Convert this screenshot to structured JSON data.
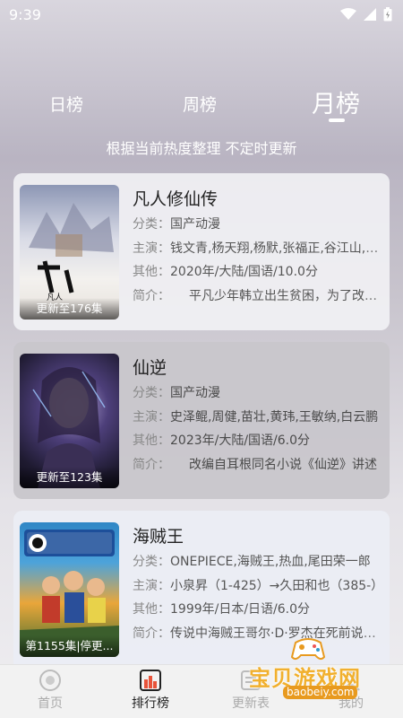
{
  "status": {
    "time": "9:39"
  },
  "tabs": [
    {
      "label": "日榜"
    },
    {
      "label": "周榜"
    },
    {
      "label": "月榜",
      "selected": true
    }
  ],
  "subtitle": "根据当前热度整理 不定时更新",
  "items": [
    {
      "title": "凡人修仙传",
      "badge": "更新至176集",
      "rows": [
        {
          "key": "分类：",
          "value": "国产动漫"
        },
        {
          "key": "主演：",
          "value": "钱文青,杨天翔,杨默,张福正,谷江山,于镜"
        },
        {
          "key": "其他：",
          "value": "2020年/大陆/国语/10.0分"
        },
        {
          "key": "简介：",
          "value": "　　平凡少年韩立出生贫困，为了改善家人"
        }
      ]
    },
    {
      "title": "仙逆",
      "badge": "更新至123集",
      "rows": [
        {
          "key": "分类：",
          "value": "国产动漫"
        },
        {
          "key": "主演：",
          "value": "史泽鲲,周健,苗壮,黄玮,王敏纳,白云鹏"
        },
        {
          "key": "其他：",
          "value": "2023年/大陆/国语/6.0分"
        },
        {
          "key": "简介：",
          "value": "　　改编自耳根同名小说《仙逆》讲述"
        }
      ]
    },
    {
      "title": "海贼王",
      "badge": "第1155集|停更...",
      "rows": [
        {
          "key": "分类：",
          "value": "ONEPIECE,海贼王,热血,尾田荣一郎"
        },
        {
          "key": "主演：",
          "value": "小泉昇（1-425）→久田和也（385-）"
        },
        {
          "key": "其他：",
          "value": "1999年/日本/日语/6.0分"
        },
        {
          "key": "简介：",
          "value": "传说中海贼王哥尔·D·罗杰在死前说出他"
        }
      ]
    }
  ],
  "nav": [
    {
      "label": "首页",
      "icon": "home-icon"
    },
    {
      "label": "排行榜",
      "icon": "ranking-icon",
      "active": true
    },
    {
      "label": "更新表",
      "icon": "schedule-icon"
    },
    {
      "label": "我的",
      "icon": "profile-icon"
    }
  ],
  "watermark": {
    "text": "宝贝游戏网",
    "url": "baobeiy.com"
  }
}
